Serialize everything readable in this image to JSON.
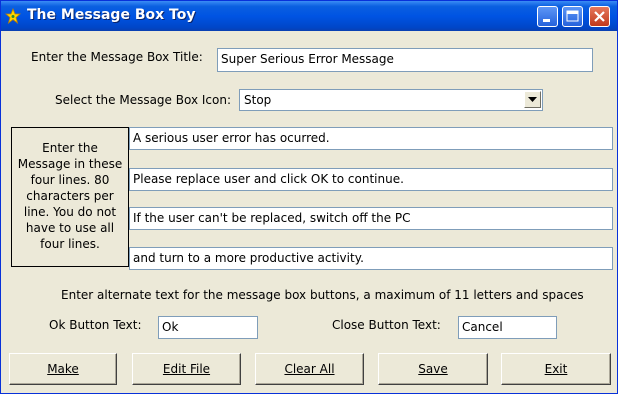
{
  "window": {
    "title": "The Message Box Toy"
  },
  "title_row": {
    "label": "Enter the Message Box Title:",
    "value": "Super Serious Error Message"
  },
  "icon_row": {
    "label": "Select the Message Box Icon:",
    "selected": "Stop"
  },
  "message": {
    "instructions": "Enter the Message in these four lines. 80 characters per line.  You do not have to use all four lines.",
    "lines": [
      "A serious user error has ocurred.",
      "Please replace user and click OK to continue.",
      "If the user can't be replaced, switch off the PC",
      "and turn to a more productive activity."
    ]
  },
  "buttons_text": {
    "instructions": "Enter alternate text for the message box buttons,  a maximum of 11 letters and spaces",
    "ok_label": "Ok Button Text:",
    "ok_value": "Ok",
    "close_label": "Close Button Text:",
    "close_value": "Cancel"
  },
  "actions": {
    "make": "Make",
    "edit_file": "Edit File",
    "clear_all": "Clear All",
    "save": "Save",
    "exit": "Exit"
  },
  "colors": {
    "titlebar": "#0054e3",
    "window_bg": "#ece9d8",
    "field_border": "#7f9db9"
  }
}
